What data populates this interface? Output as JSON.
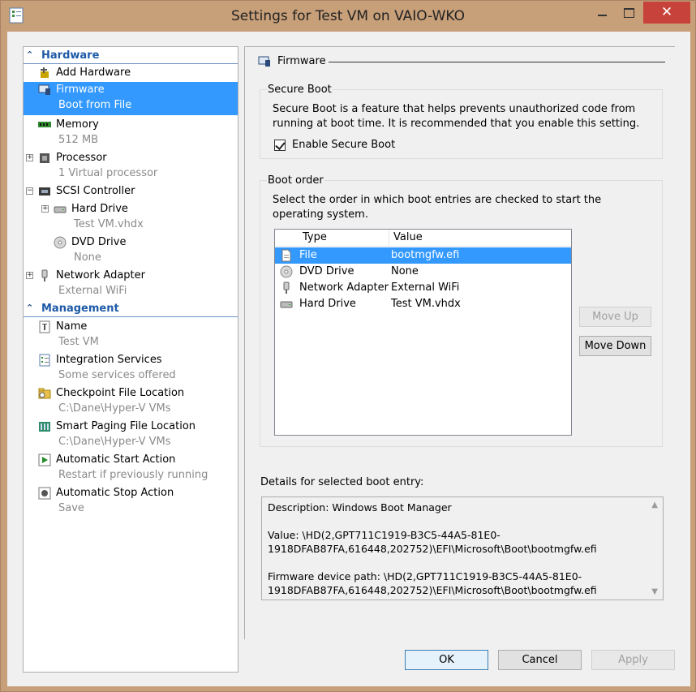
{
  "window": {
    "title": "Settings for Test VM on VAIO-WKO",
    "close_glyph": "✕"
  },
  "tree": {
    "hardware_header": "Hardware",
    "management_header": "Management",
    "hardware": [
      {
        "name": "Add Hardware",
        "sub": ""
      },
      {
        "name": "Firmware",
        "sub": "Boot from File"
      },
      {
        "name": "Memory",
        "sub": "512 MB"
      },
      {
        "name": "Processor",
        "sub": "1 Virtual processor"
      },
      {
        "name": "SCSI Controller",
        "sub": ""
      },
      {
        "name": "Hard Drive",
        "sub": "Test VM.vhdx"
      },
      {
        "name": "DVD Drive",
        "sub": "None"
      },
      {
        "name": "Network Adapter",
        "sub": "External WiFi"
      }
    ],
    "management": [
      {
        "name": "Name",
        "sub": "Test VM"
      },
      {
        "name": "Integration Services",
        "sub": "Some services offered"
      },
      {
        "name": "Checkpoint File Location",
        "sub": "C:\\Dane\\Hyper-V VMs"
      },
      {
        "name": "Smart Paging File Location",
        "sub": "C:\\Dane\\Hyper-V VMs"
      },
      {
        "name": "Automatic Start Action",
        "sub": "Restart if previously running"
      },
      {
        "name": "Automatic Stop Action",
        "sub": "Save"
      }
    ]
  },
  "panel": {
    "title": "Firmware",
    "secure_boot": {
      "group_title": "Secure Boot",
      "description": "Secure Boot is a feature that helps prevents unauthorized code from running at boot time. It is recommended that you enable this setting.",
      "checkbox_label": "Enable Secure Boot",
      "checked": true
    },
    "boot_order": {
      "group_title": "Boot order",
      "description": "Select the order in which boot entries are checked to start the operating system.",
      "columns": [
        "Type",
        "Value"
      ],
      "rows": [
        {
          "type": "File",
          "value": "bootmgfw.efi"
        },
        {
          "type": "DVD Drive",
          "value": "None"
        },
        {
          "type": "Network Adapter",
          "value": "External WiFi"
        },
        {
          "type": "Hard Drive",
          "value": "Test VM.vhdx"
        }
      ],
      "move_up": "Move Up",
      "move_down": "Move Down"
    },
    "details": {
      "label": "Details for selected boot entry:",
      "lines": [
        "Description: Windows Boot Manager",
        "",
        "Value: \\HD(2,GPT711C1919-B3C5-44A5-81E0-",
        "1918DFAB87FA,616448,202752)\\EFI\\Microsoft\\Boot\\bootmgfw.efi",
        "",
        "Firmware device path: \\HD(2,GPT711C1919-B3C5-44A5-81E0-",
        "1918DFAB87FA,616448,202752)\\EFI\\Microsoft\\Boot\\bootmgfw.efi"
      ]
    }
  },
  "buttons": {
    "ok": "OK",
    "cancel": "Cancel",
    "apply": "Apply"
  },
  "colors": {
    "selection": "#3399ff",
    "section_header": "#1e5aa8",
    "window_frame": "#c79f79"
  }
}
